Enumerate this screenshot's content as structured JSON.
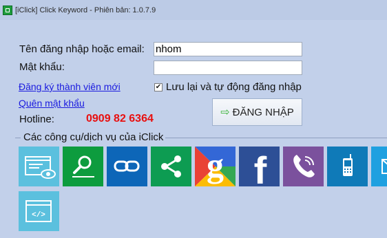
{
  "window": {
    "title": "[iClick] Click Keyword - Phiên bản: 1.0.7.9"
  },
  "form": {
    "username_label": "Tên đăng nhập hoặc email:",
    "username_value": "nhom",
    "password_label": "Mật khẩu:",
    "password_value": "",
    "register_link": "Đăng ký thành viên mới",
    "forgot_link": "Quên mật khẩu",
    "remember_label": "Lưu lại và tự động đăng nhập",
    "remember_checked": true,
    "remember_mark": "✔",
    "login_button": "ĐĂNG NHẬP",
    "login_arrow": "⇨",
    "hotline_label": "Hotline:",
    "hotline_number": "0909 82 6364"
  },
  "tools": {
    "section_label": "Các công cụ/dịch vụ của iClick",
    "tiles": [
      {
        "icon": "browser-eye-icon",
        "color": "#5bc0de"
      },
      {
        "icon": "magnifier-icon",
        "color": "#0d9c3e"
      },
      {
        "icon": "chain-link-icon",
        "color": "#0d66b8"
      },
      {
        "icon": "share-icon",
        "color": "#0d9c52"
      },
      {
        "icon": "google-icon",
        "color": "#3367d6"
      },
      {
        "icon": "facebook-icon",
        "color": "#2d4f96"
      },
      {
        "icon": "viber-icon",
        "color": "#7b519d"
      },
      {
        "icon": "mobile-phone-icon",
        "color": "#0f7ab8"
      },
      {
        "icon": "email-icon",
        "color": "#1fa0e0"
      },
      {
        "icon": "code-window-icon",
        "color": "#5bc0de"
      }
    ]
  }
}
